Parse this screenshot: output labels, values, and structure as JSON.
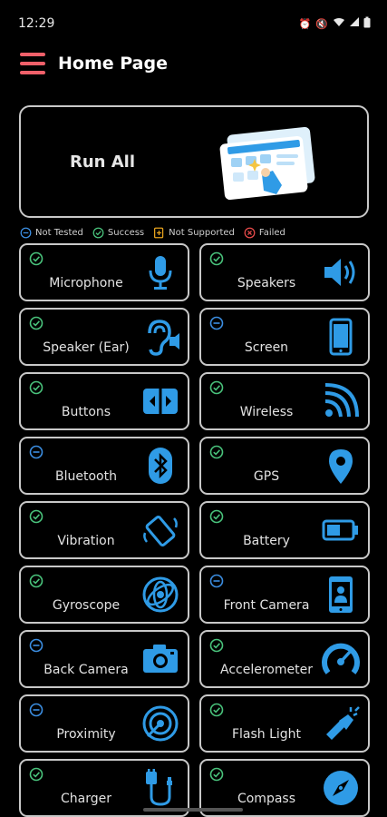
{
  "status_bar": {
    "time": "12:29",
    "icons": [
      "alarm-icon",
      "mute-icon",
      "wifi-icon",
      "signal-icon",
      "battery-icon"
    ]
  },
  "header": {
    "title": "Home Page",
    "menu_icon": "hamburger-menu-icon"
  },
  "run_all": {
    "label": "Run All",
    "illustration": "dashboard-illustration"
  },
  "legend": [
    {
      "label": "Not Tested",
      "status": "not-tested"
    },
    {
      "label": "Success",
      "status": "success"
    },
    {
      "label": "Not Supported",
      "status": "not-supported"
    },
    {
      "label": "Failed",
      "status": "failed"
    }
  ],
  "colors": {
    "accent": "#2f9be6",
    "success": "#49c27b",
    "not_tested": "#3b8de0",
    "not_supported": "#e6a21d",
    "failed": "#e64a4a",
    "menu": "#f0606a"
  },
  "tests": [
    {
      "label": "Microphone",
      "status": "success",
      "icon": "microphone-icon"
    },
    {
      "label": "Speakers",
      "status": "success",
      "icon": "speaker-icon"
    },
    {
      "label": "Speaker (Ear)",
      "status": "success",
      "icon": "ear-speaker-icon"
    },
    {
      "label": "Screen",
      "status": "not-tested",
      "icon": "phone-screen-icon"
    },
    {
      "label": "Buttons",
      "status": "success",
      "icon": "buttons-icon"
    },
    {
      "label": "Wireless",
      "status": "success",
      "icon": "wireless-icon"
    },
    {
      "label": "Bluetooth",
      "status": "not-tested",
      "icon": "bluetooth-icon"
    },
    {
      "label": "GPS",
      "status": "success",
      "icon": "location-pin-icon"
    },
    {
      "label": "Vibration",
      "status": "success",
      "icon": "vibration-icon"
    },
    {
      "label": "Battery",
      "status": "success",
      "icon": "battery-icon"
    },
    {
      "label": "Gyroscope",
      "status": "success",
      "icon": "gyroscope-icon"
    },
    {
      "label": "Front Camera",
      "status": "not-tested",
      "icon": "front-camera-icon"
    },
    {
      "label": "Back Camera",
      "status": "not-tested",
      "icon": "camera-icon"
    },
    {
      "label": "Accelerometer",
      "status": "success",
      "icon": "speedometer-icon"
    },
    {
      "label": "Proximity",
      "status": "not-tested",
      "icon": "proximity-icon"
    },
    {
      "label": "Flash Light",
      "status": "success",
      "icon": "flashlight-icon"
    },
    {
      "label": "Charger",
      "status": "success",
      "icon": "charger-icon"
    },
    {
      "label": "Compass",
      "status": "success",
      "icon": "compass-icon"
    }
  ]
}
